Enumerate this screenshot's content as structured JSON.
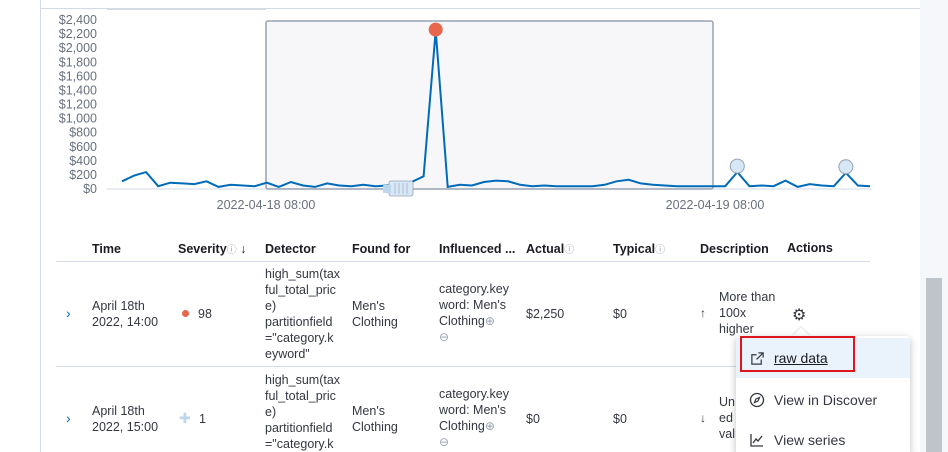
{
  "chart": {
    "y_ticks": [
      "$2,400",
      "$2,200",
      "$2,000",
      "$1,800",
      "$1,600",
      "$1,400",
      "$1,200",
      "$1,000",
      "$800",
      "$600",
      "$400",
      "$200",
      "$0"
    ],
    "x_ticks": [
      "2022-04-18 08:00",
      "2022-04-19 08:00"
    ],
    "line_color": "#006bb8",
    "anomaly_high_color": "#e7664c",
    "anomaly_low_color": "#d6e7f6"
  },
  "chart_data": {
    "type": "line",
    "ylim": [
      0,
      2400
    ],
    "x": [
      "0",
      "1",
      "2",
      "3",
      "4",
      "5",
      "6",
      "7",
      "8",
      "9",
      "10",
      "11",
      "12",
      "13",
      "14",
      "15",
      "16",
      "17",
      "18",
      "19",
      "20",
      "21",
      "22",
      "23",
      "24",
      "25",
      "26",
      "27",
      "28",
      "29",
      "30",
      "31",
      "32",
      "33",
      "34",
      "35",
      "36",
      "37",
      "38",
      "39",
      "40",
      "41",
      "42",
      "43",
      "44",
      "45",
      "46",
      "47",
      "48",
      "49",
      "50",
      "51",
      "52",
      "53",
      "54",
      "55",
      "56",
      "57",
      "58",
      "59",
      "60",
      "61",
      "62"
    ],
    "values": [
      110,
      190,
      240,
      40,
      90,
      80,
      70,
      110,
      30,
      60,
      50,
      40,
      90,
      30,
      100,
      50,
      30,
      80,
      50,
      40,
      60,
      40,
      50,
      60,
      100,
      180,
      2250,
      30,
      60,
      50,
      100,
      120,
      110,
      60,
      40,
      50,
      40,
      40,
      40,
      40,
      60,
      110,
      130,
      80,
      60,
      50,
      40,
      40,
      40,
      40,
      40,
      240,
      40,
      50,
      40,
      120,
      30,
      70,
      50,
      40,
      230,
      50,
      40
    ]
  },
  "table": {
    "headers": {
      "time": "Time",
      "severity": "Severity",
      "detector": "Detector",
      "found_for": "Found for",
      "influenced": "Influenced ...",
      "actual": "Actual",
      "typical": "Typical",
      "description": "Description",
      "actions": "Actions"
    },
    "rows": [
      {
        "time_line1": "April 18th",
        "time_line2": "2022, 14:00",
        "severity": "98",
        "detector": [
          "high_sum(tax",
          "ful_total_pric",
          "e)",
          "partitionfield",
          "=\"category.k",
          "eyword\""
        ],
        "found_for": [
          "Men's",
          "Clothing"
        ],
        "influenced": [
          "category.key",
          "word: Men's",
          "Clothing"
        ],
        "actual": "$2,250",
        "typical": "$0",
        "description": [
          "More than",
          "100x",
          "higher"
        ]
      },
      {
        "time_line1": "April 18th",
        "time_line2": "2022, 15:00",
        "severity": "1",
        "detector": [
          "high_sum(tax",
          "ful_total_pric",
          "e)",
          "partitionfield",
          "=\"category.k"
        ],
        "found_for": [
          "Men's",
          "Clothing"
        ],
        "influenced": [
          "category.key",
          "word: Men's",
          "Clothing"
        ],
        "actual": "$0",
        "typical": "$0",
        "description": [
          "Un",
          "ed",
          "val"
        ]
      }
    ]
  },
  "popover": {
    "items": [
      {
        "label": "raw data",
        "icon": "external-link-icon"
      },
      {
        "label": "View in Discover",
        "icon": "compass-icon"
      },
      {
        "label": "View series",
        "icon": "line-chart-icon"
      }
    ]
  }
}
